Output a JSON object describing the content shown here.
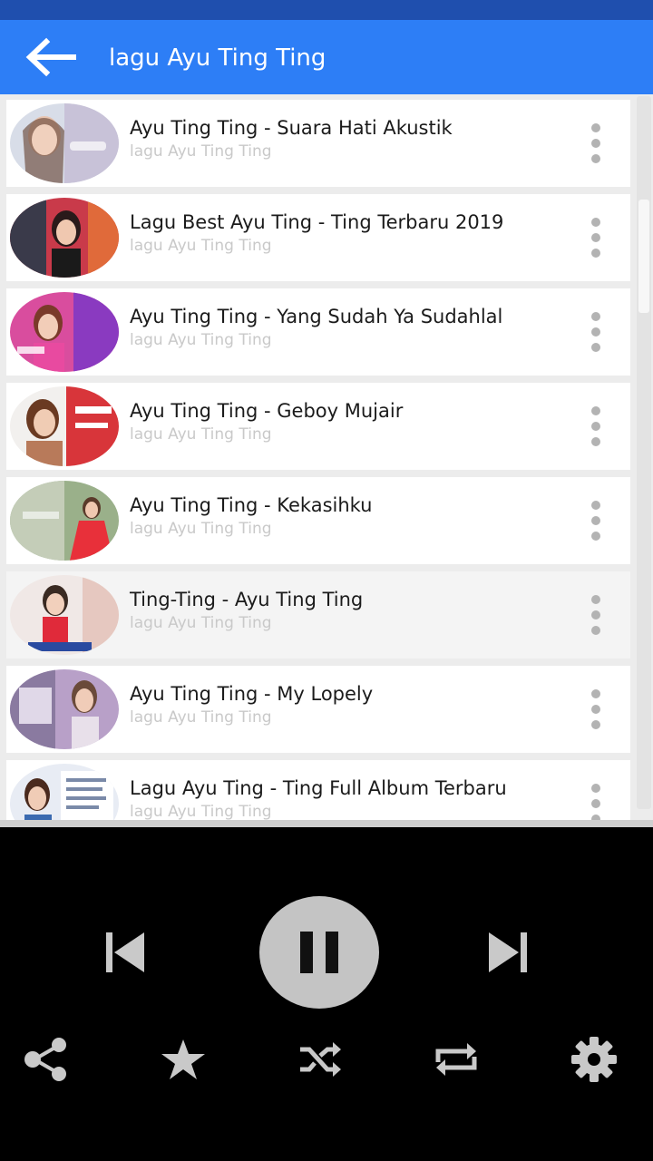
{
  "app_bar": {
    "title": "lagu Ayu Ting Ting",
    "color": "#2d7ef6"
  },
  "songs": [
    {
      "title": "Ayu Ting Ting - Suara Hati Akustik",
      "subtitle": "lagu Ayu Ting Ting"
    },
    {
      "title": "Lagu Best Ayu Ting - Ting Terbaru 2019",
      "subtitle": "lagu Ayu Ting Ting"
    },
    {
      "title": "Ayu Ting Ting - Yang Sudah Ya Sudahlal",
      "subtitle": "lagu Ayu Ting Ting"
    },
    {
      "title": "Ayu Ting Ting - Geboy Mujair",
      "subtitle": "lagu Ayu Ting Ting"
    },
    {
      "title": "Ayu Ting Ting - Kekasihku",
      "subtitle": "lagu Ayu Ting Ting"
    },
    {
      "title": "Ting-Ting  - Ayu Ting Ting",
      "subtitle": "lagu Ayu Ting Ting"
    },
    {
      "title": "Ayu Ting Ting - My Lopely",
      "subtitle": "lagu Ayu Ting Ting"
    },
    {
      "title": "Lagu Ayu Ting - Ting Full Album Terbaru",
      "subtitle": "lagu Ayu Ting Ting"
    }
  ],
  "player": {
    "state": "playing",
    "controls": [
      "skip-previous-icon",
      "pause-icon",
      "skip-next-icon"
    ],
    "actions": [
      "share-icon",
      "star-icon",
      "shuffle-icon",
      "repeat-icon",
      "gear-icon"
    ]
  }
}
